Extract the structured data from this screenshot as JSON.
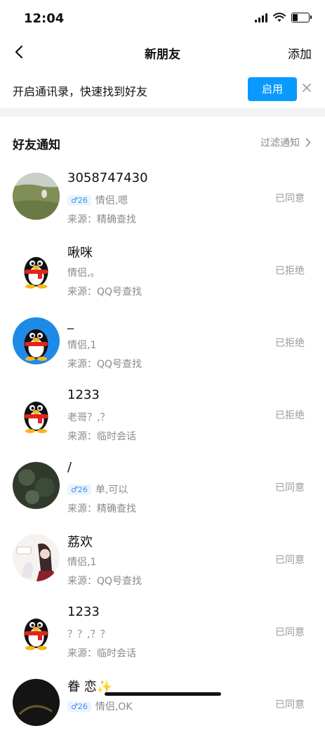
{
  "status_bar": {
    "time": "12:04"
  },
  "nav": {
    "title": "新朋友",
    "add_label": "添加"
  },
  "contacts_banner": {
    "text": "开启通讯录，快速找到好友",
    "enable_label": "启用"
  },
  "section": {
    "title": "好友通知",
    "filter_label": "过滤通知"
  },
  "requests": [
    {
      "name": "3058747430",
      "gender_badge": "♂26",
      "message": "情侣,嗯",
      "source": "来源：精确查找",
      "status": "已同意",
      "avatar": "landscape-photo"
    },
    {
      "name": "啾咪",
      "gender_badge": "",
      "message": "情侣,。",
      "source": "来源：QQ号查找",
      "status": "已拒绝",
      "avatar": "qq-penguin"
    },
    {
      "name": "_",
      "gender_badge": "",
      "message": "情侣,1",
      "source": "来源：QQ号查找",
      "status": "已拒绝",
      "avatar": "qq-penguin-blue"
    },
    {
      "name": "1233",
      "gender_badge": "",
      "message": "老哥？,？",
      "source": "来源：临时会话",
      "status": "已拒绝",
      "avatar": "qq-penguin"
    },
    {
      "name": "/",
      "gender_badge": "♂26",
      "message": "单,可以",
      "source": "来源：精确查找",
      "status": "已同意",
      "avatar": "dark-photo"
    },
    {
      "name": "荔欢",
      "gender_badge": "",
      "message": "情侣,1",
      "source": "来源：QQ号查找",
      "status": "已同意",
      "avatar": "anime-drawing"
    },
    {
      "name": "1233",
      "gender_badge": "",
      "message": "？？,？？",
      "source": "来源：临时会话",
      "status": "已同意",
      "avatar": "qq-penguin"
    },
    {
      "name": "眷  恋✨",
      "gender_badge": "♂26",
      "message": "情侣,OK",
      "source": "",
      "status": "已同意",
      "avatar": "dark-photo"
    }
  ],
  "colors": {
    "accent": "#0a99ff",
    "secondary_text": "#8a8a8a",
    "divider": "#f2f3f5"
  }
}
